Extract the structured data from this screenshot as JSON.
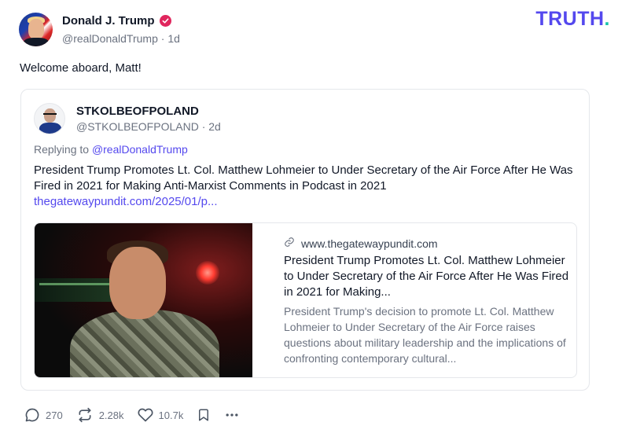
{
  "post": {
    "author": {
      "display_name": "Donald J. Trump",
      "handle": "@realDonaldTrump",
      "time": "1d"
    },
    "text": "Welcome aboard, Matt!"
  },
  "brand": {
    "text": "TRUTH",
    "dot": ".",
    "color": "#5448ee",
    "dot_color": "#17c4a8"
  },
  "quoted": {
    "author": {
      "display_name": "STKOLBEOFPOLAND",
      "handle": "@STKOLBEOFPOLAND",
      "time": "2d"
    },
    "replying_prefix": "Replying to ",
    "replying_to": "@realDonaldTrump",
    "body": "President Trump Promotes Lt. Col. Matthew Lohmeier to Under Secretary of the Air Force After He Was Fired in 2021 for Making Anti-Marxist Comments in Podcast in 2021",
    "link_text": "thegatewaypundit.com/2025/01/p...",
    "card": {
      "domain": "www.thegatewaypundit.com",
      "title": "President Trump Promotes Lt. Col. Matthew Lohmeier to Under Secretary of the Air Force After He Was Fired in 2021 for Making...",
      "description": "President Trump's decision to promote Lt. Col. Matthew Lohmeier to Under Secretary of the Air Force raises questions about military leadership and the implications of confronting contemporary cultural..."
    }
  },
  "actions": {
    "replies": "270",
    "retruths": "2.28k",
    "likes": "10.7k"
  },
  "icons": [
    "avatar",
    "verified-badge-icon",
    "link-icon",
    "reply-icon",
    "retruth-icon",
    "like-icon",
    "bookmark-icon",
    "more-icon"
  ],
  "colors": {
    "accent": "#5448ee",
    "verified": "#e0265d",
    "muted": "#6b7280"
  }
}
